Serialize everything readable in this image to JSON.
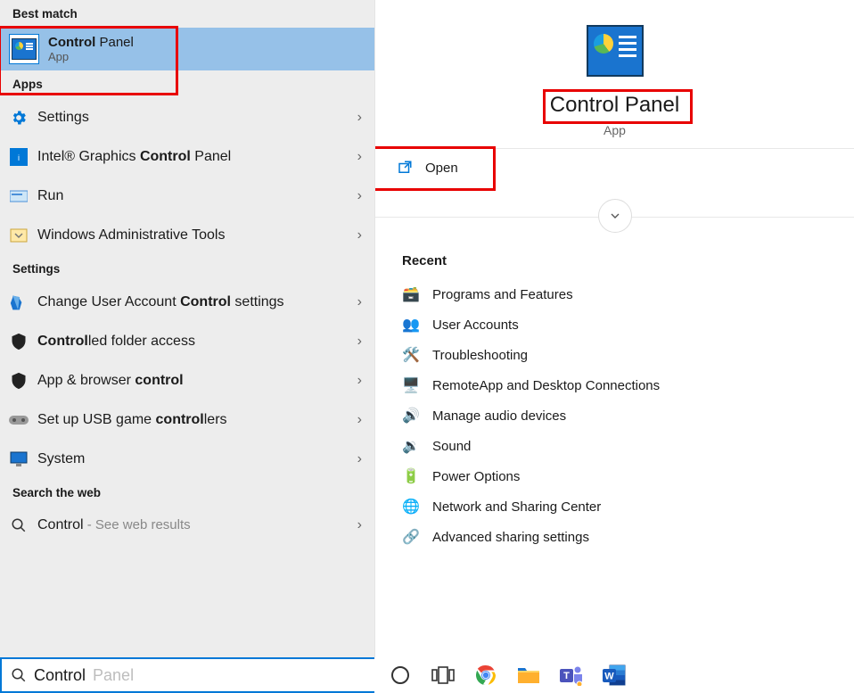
{
  "left": {
    "bestMatchHeader": "Best match",
    "best": {
      "titleBold": "Control",
      "titleRest": " Panel",
      "sub": "App"
    },
    "appsHeader": "Apps",
    "apps": [
      {
        "name": "settings",
        "label": "Settings",
        "bold": ""
      },
      {
        "name": "intel-graphics",
        "label": "Intel® Graphics <b>Control</b> Panel"
      },
      {
        "name": "run",
        "label": "Run"
      },
      {
        "name": "admin-tools",
        "label": "Windows Administrative Tools"
      }
    ],
    "settingsHeader": "Settings",
    "settings": [
      {
        "name": "uac",
        "label": "Change User Account <b>Control</b> settings"
      },
      {
        "name": "folder-access",
        "label": "<b>Control</b>led folder access"
      },
      {
        "name": "app-browser",
        "label": "App & browser <b>control</b>"
      },
      {
        "name": "usb-game",
        "label": "Set up USB game <b>control</b>lers"
      },
      {
        "name": "system",
        "label": "System"
      }
    ],
    "webHeader": "Search the web",
    "web": {
      "query": "Control",
      "suffix": " - See web results"
    }
  },
  "right": {
    "title": "Control Panel",
    "sub": "App",
    "open": "Open",
    "recentHeader": "Recent",
    "recent": [
      {
        "name": "programs-features",
        "label": "Programs and Features"
      },
      {
        "name": "user-accounts",
        "label": "User Accounts"
      },
      {
        "name": "troubleshooting",
        "label": "Troubleshooting"
      },
      {
        "name": "remoteapp",
        "label": "RemoteApp and Desktop Connections"
      },
      {
        "name": "audio-devices",
        "label": "Manage audio devices"
      },
      {
        "name": "sound",
        "label": "Sound"
      },
      {
        "name": "power-options",
        "label": "Power Options"
      },
      {
        "name": "network-sharing",
        "label": "Network and Sharing Center"
      },
      {
        "name": "advanced-sharing",
        "label": "Advanced sharing settings"
      }
    ]
  },
  "search": {
    "typed": "Control",
    "ghost": " Panel"
  },
  "taskbar": [
    "cortana",
    "task-view",
    "chrome",
    "file-explorer",
    "teams",
    "word"
  ]
}
